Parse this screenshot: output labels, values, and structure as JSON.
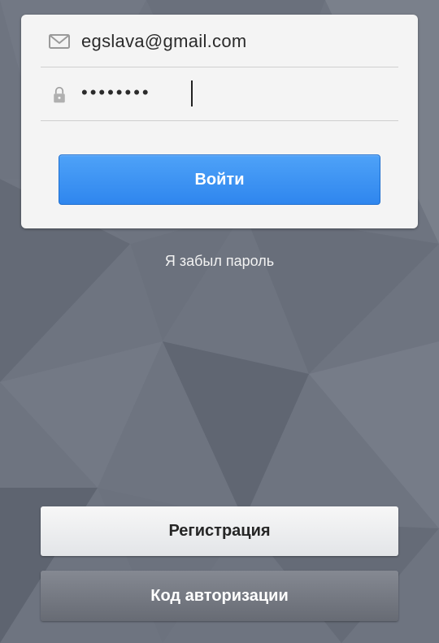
{
  "login_form": {
    "email_value": "egslava@gmail.com",
    "password_value": "••••••••",
    "login_label": "Войти"
  },
  "forgot_password_label": "Я забыл пароль",
  "bottom_actions": {
    "register_label": "Регистрация",
    "auth_code_label": "Код авторизации"
  },
  "icons": {
    "email": "mail-icon",
    "password": "lock-icon"
  },
  "colors": {
    "background": "#6e7480",
    "card": "#f4f4f4",
    "primary_button": "#3b8ff3",
    "secondary_dark_button": "#757982"
  }
}
